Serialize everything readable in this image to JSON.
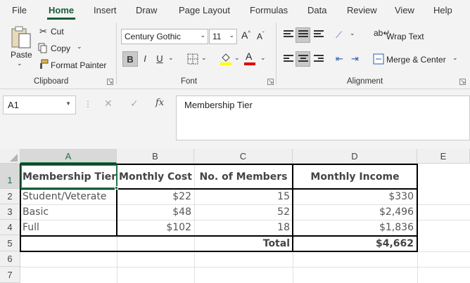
{
  "ribbon_tabs": [
    "File",
    "Home",
    "Insert",
    "Draw",
    "Page Layout",
    "Formulas",
    "Data",
    "Review",
    "View",
    "Help"
  ],
  "clipboard": {
    "paste": "Paste",
    "cut": "Cut",
    "copy": "Copy",
    "format_painter": "Format Painter",
    "group_label": "Clipboard"
  },
  "font": {
    "name": "Century Gothic",
    "size": "11",
    "grow": "A^",
    "shrink": "Aˇ",
    "bold": "B",
    "italic": "I",
    "underline": "U",
    "group_label": "Font"
  },
  "alignment": {
    "wrap_text": "Wrap Text",
    "merge_center": "Merge & Center",
    "group_label": "Alignment"
  },
  "formula_bar": {
    "name_box": "A1",
    "fx": "fx",
    "content": "Membership Tier"
  },
  "columns": [
    "A",
    "B",
    "C",
    "D",
    "E"
  ],
  "rows": [
    "1",
    "2",
    "3",
    "4",
    "5",
    "6",
    "7"
  ],
  "table": {
    "headers": [
      "Membership Tier",
      "Monthly Cost",
      "No. of Members",
      "Monthly Income"
    ],
    "rows": [
      {
        "tier": "Student/Veterate",
        "cost": "$22",
        "members": "15",
        "income": "$330"
      },
      {
        "tier": "Basic",
        "cost": "$48",
        "members": "52",
        "income": "$2,496"
      },
      {
        "tier": "Full",
        "cost": "$102",
        "members": "18",
        "income": "$1,836"
      }
    ],
    "total_label": "Total",
    "total_value": "$4,662"
  },
  "colors": {
    "accent": "#185c37",
    "selection": "#217346",
    "font_color_bar": "#e00000",
    "highlight_bar": "#ffff00"
  }
}
